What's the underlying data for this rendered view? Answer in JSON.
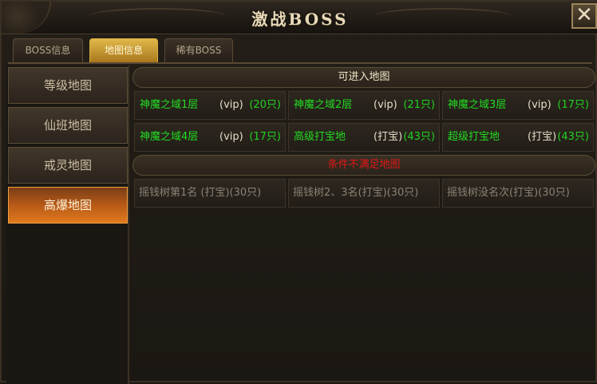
{
  "window": {
    "title": "激战BOSS",
    "close_label": "✕"
  },
  "tabs": [
    {
      "label": "BOSS信息",
      "active": false
    },
    {
      "label": "地图信息",
      "active": true
    },
    {
      "label": "稀有BOSS",
      "active": false
    }
  ],
  "sidebar": [
    {
      "label": "等级地图",
      "active": false
    },
    {
      "label": "仙班地图",
      "active": false
    },
    {
      "label": "戒灵地图",
      "active": false
    },
    {
      "label": "高爆地图",
      "active": true
    }
  ],
  "available": {
    "header": "可进入地图",
    "maps": [
      {
        "name": "神魔之域1层",
        "tag": "(vip)",
        "count": "(20只)"
      },
      {
        "name": "神魔之域2层",
        "tag": "(vip)",
        "count": "(21只)"
      },
      {
        "name": "神魔之域3层",
        "tag": "(vip)",
        "count": "(17只)"
      },
      {
        "name": "神魔之域4层",
        "tag": "(vip)",
        "count": "(17只)"
      },
      {
        "name": "高级打宝地",
        "tag": "(打宝)",
        "count": "(43只)"
      },
      {
        "name": "超级打宝地",
        "tag": "(打宝)",
        "count": "(43只)"
      }
    ]
  },
  "locked": {
    "header": "条件不满足地图",
    "maps": [
      {
        "text": "摇钱树第1名 (打宝)(30只)"
      },
      {
        "text": "摇钱树2、3名(打宝)(30只)"
      },
      {
        "text": "摇钱树没名次(打宝)(30只)"
      }
    ]
  },
  "colors": {
    "accent_gold": "#e1b84b",
    "active_orange": "#e07a1e",
    "available_green": "#22dc22",
    "unavailable_red": "#e01818",
    "locked_gray": "#8a8275"
  }
}
